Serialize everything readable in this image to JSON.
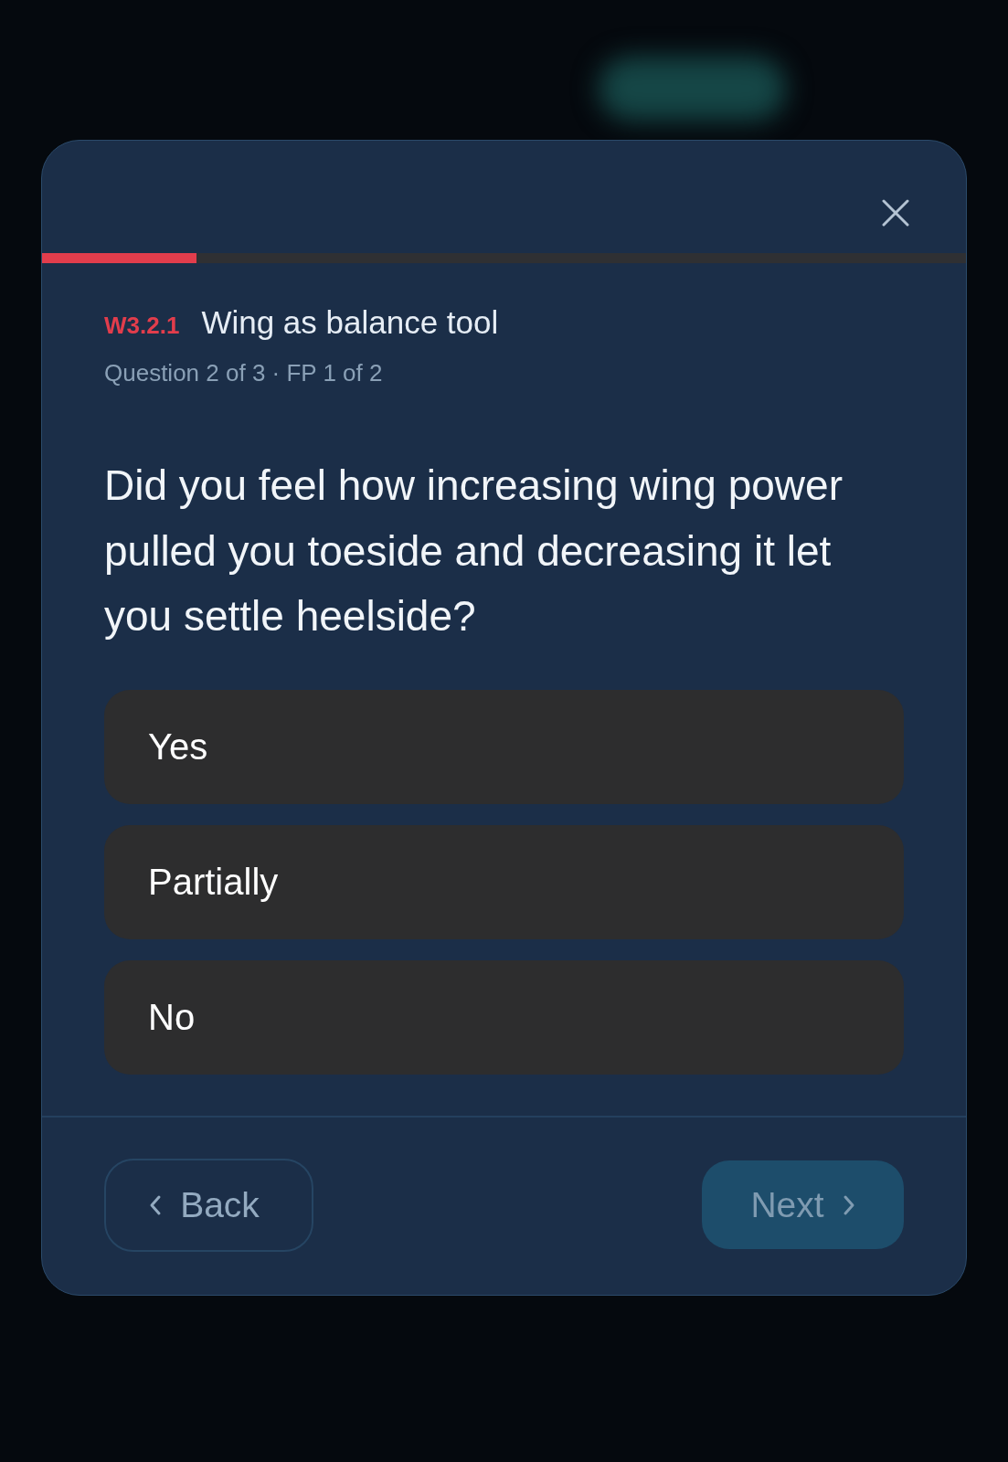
{
  "progress": {
    "level": 0.167
  },
  "header": {
    "code": "W3.2.1",
    "title": "Wing as balance tool",
    "subtitle": "Question 2 of 3 · FP 1 of 2"
  },
  "question": "Did you feel how increasing wing power pulled you toeside and decreasing it let you settle heelside?",
  "options": [
    {
      "label": "Yes",
      "selected": false
    },
    {
      "label": "Partially",
      "selected": false
    },
    {
      "label": "No",
      "selected": false
    }
  ],
  "footer": {
    "back": {
      "label": "Back"
    },
    "next": {
      "label": "Next",
      "disabled": true
    }
  }
}
